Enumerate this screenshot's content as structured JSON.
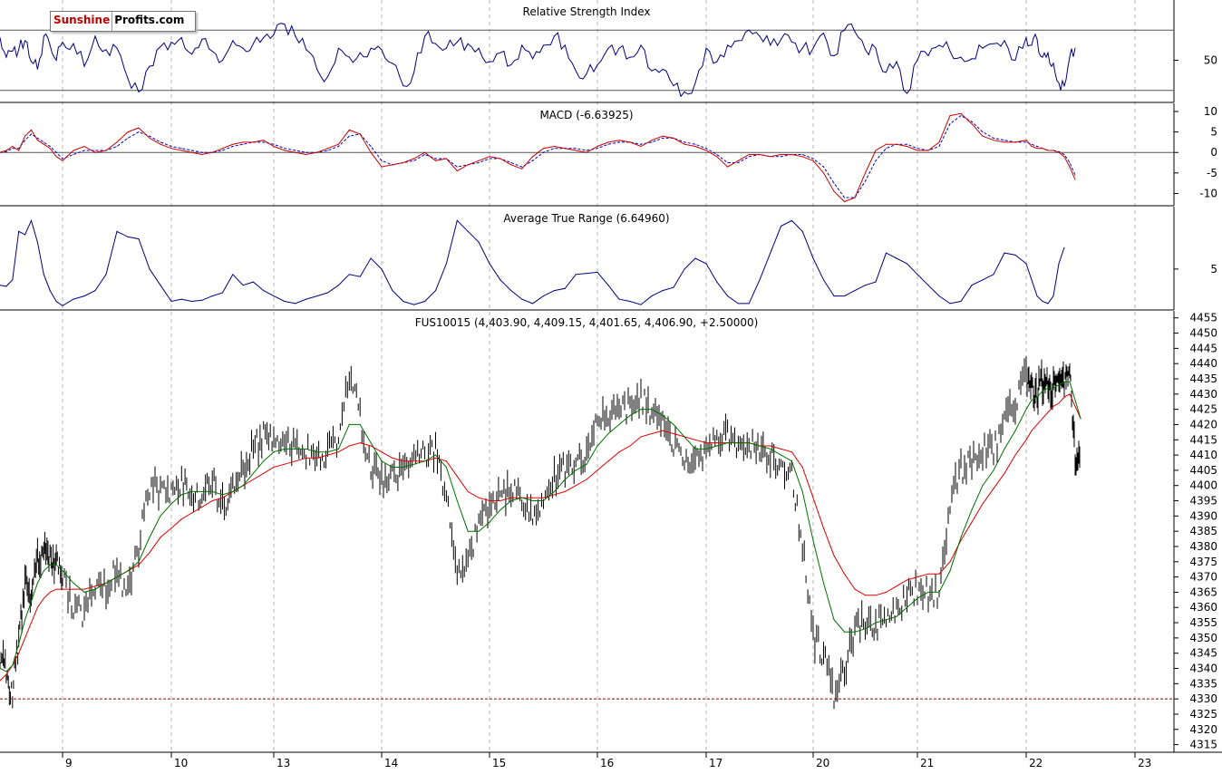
{
  "logo": {
    "part_a": "Sunshine",
    "part_b": "Profits.com"
  },
  "colors": {
    "price": "#000000",
    "rsi": "#000080",
    "macd": "#cc0000",
    "signal": "#0000cc",
    "atr": "#000080",
    "ma_short": "#007000",
    "ma_long": "#e00000",
    "grid": "#b4b4b4",
    "support": "#8b0000"
  },
  "chart_data": [
    {
      "type": "line",
      "title": "Relative Strength Index",
      "y_ticks": [
        50
      ],
      "reference_lines": [
        30,
        70
      ],
      "ylim": [
        22,
        90
      ],
      "series": [
        {
          "values": [
            65,
            52,
            56,
            57,
            63,
            49,
            44,
            66,
            60,
            50,
            62,
            61,
            46,
            66,
            57,
            58,
            38,
            29,
            46,
            59,
            62,
            65,
            54,
            64,
            56,
            50,
            63,
            58,
            61,
            65,
            67,
            74,
            66,
            57,
            44,
            39,
            58,
            52,
            55,
            58,
            57,
            48,
            33,
            42,
            66,
            61,
            58,
            62,
            61,
            58,
            49,
            55,
            47,
            60,
            51,
            60,
            66,
            60,
            43,
            41,
            47,
            58,
            58,
            52,
            60,
            43,
            44,
            33,
            29,
            35,
            58,
            49,
            60,
            63,
            70,
            66,
            60,
            64,
            62,
            58,
            58,
            68,
            53,
            70,
            69,
            57,
            58,
            42,
            49,
            28,
            50,
            53,
            60,
            56,
            52,
            51,
            58,
            61,
            63,
            50,
            65,
            60,
            64,
            52,
            55,
            48,
            35,
            33,
            52,
            58
          ]
        }
      ]
    },
    {
      "type": "line",
      "title": "MACD (-6.63925)",
      "y_ticks": [
        10,
        5,
        0,
        -5,
        -10
      ],
      "ylim": [
        -13,
        12
      ],
      "series": [
        {
          "values": [
            0.0,
            0.5,
            1.5,
            0.5,
            4.0,
            5.5,
            3.0,
            2.0,
            1.0,
            -1.0,
            -2.0,
            0.5,
            1.5,
            0.0,
            0.5,
            2.5,
            5.0,
            6.0,
            3.5,
            2.0,
            1.0,
            0.5,
            0.0,
            -0.5,
            0.0,
            1.0,
            2.0,
            2.5,
            2.5,
            3.0,
            1.5,
            0.5,
            0.0,
            -0.5,
            0.0,
            1.0,
            2.0,
            5.5,
            4.5,
            0.0,
            -3.5,
            -3.0,
            -2.5,
            -1.5,
            0.0,
            -2.0,
            -1.5,
            -4.5,
            -3.0,
            -2.0,
            -1.0,
            -1.5,
            -3.0,
            -4.0,
            -1.0,
            1.0,
            1.5,
            1.0,
            0.5,
            0.0,
            1.5,
            2.5,
            3.0,
            2.5,
            1.5,
            3.0,
            4.0,
            3.5,
            2.0,
            1.5,
            0.5,
            -1.0,
            -3.5,
            -2.0,
            -0.5,
            -0.5,
            -1.0,
            -0.5,
            -0.5,
            -1.0,
            -2.0,
            -5.0,
            -9.5,
            -12.0,
            -11.0,
            -5.0,
            0.5,
            2.0,
            2.0,
            1.5,
            0.5,
            0.5,
            2.5,
            9.0,
            9.5,
            7.0,
            4.0,
            3.0,
            2.5,
            2.5,
            3.0,
            1.5,
            1.0,
            1.0,
            0.5,
            0.5,
            0.0,
            -1.0,
            -3.5,
            -6.6
          ]
        },
        {
          "values": [
            0.0,
            0.2,
            1.0,
            1.0,
            3.0,
            4.5,
            3.5,
            2.5,
            1.5,
            0.0,
            -1.5,
            -0.5,
            0.5,
            0.5,
            0.5,
            1.5,
            3.5,
            5.0,
            4.0,
            2.5,
            1.5,
            1.0,
            0.5,
            0.0,
            0.0,
            0.5,
            1.5,
            2.0,
            2.5,
            2.5,
            2.0,
            1.0,
            0.5,
            0.0,
            0.0,
            0.5,
            1.5,
            4.0,
            4.5,
            1.5,
            -2.0,
            -3.0,
            -2.5,
            -2.0,
            -0.5,
            -1.5,
            -1.5,
            -3.5,
            -3.0,
            -2.5,
            -1.5,
            -1.5,
            -2.5,
            -3.5,
            -2.0,
            0.0,
            1.0,
            1.0,
            1.0,
            0.5,
            1.0,
            2.0,
            2.5,
            2.5,
            2.0,
            2.5,
            3.5,
            3.5,
            2.5,
            2.0,
            1.0,
            -0.5,
            -2.5,
            -2.5,
            -1.0,
            -0.5,
            -1.0,
            -1.0,
            -0.5,
            -0.5,
            -1.5,
            -3.5,
            -7.5,
            -11.0,
            -11.0,
            -7.0,
            -2.0,
            1.0,
            2.0,
            2.0,
            1.0,
            0.5,
            1.5,
            7.0,
            9.0,
            7.5,
            5.0,
            3.5,
            3.0,
            2.5,
            2.5,
            2.0,
            1.5,
            1.0,
            0.5,
            0.5,
            0.2,
            -0.5,
            -2.5,
            -5.5
          ]
        }
      ]
    },
    {
      "type": "line",
      "title": "Average True Range (6.64960)",
      "y_ticks": [
        5
      ],
      "ylim": [
        1.2,
        10.8
      ],
      "series": [
        {
          "values": [
            3.5,
            3.4,
            4.0,
            8.5,
            8.2,
            9.5,
            7.5,
            4.5,
            3.0,
            2.0,
            1.6,
            2.2,
            2.5,
            3.0,
            4.5,
            8.5,
            8.0,
            7.8,
            5.0,
            3.5,
            2.0,
            2.2,
            2.0,
            2.1,
            2.5,
            2.8,
            4.5,
            3.5,
            3.8,
            3.0,
            2.5,
            2.0,
            1.8,
            2.2,
            2.5,
            2.8,
            3.5,
            4.5,
            4.3,
            6.0,
            5.0,
            3.0,
            2.0,
            1.7,
            2.0,
            3.0,
            5.5,
            9.5,
            8.5,
            7.5,
            5.5,
            4.0,
            3.0,
            2.2,
            1.8,
            2.5,
            3.0,
            3.2,
            4.5,
            4.6,
            4.7,
            3.5,
            2.2,
            2.0,
            1.7,
            2.5,
            3.0,
            3.3,
            5.0,
            6.0,
            5.5,
            3.8,
            2.5,
            1.8,
            1.8,
            4.0,
            6.5,
            9.0,
            9.5,
            8.5,
            6.0,
            4.0,
            2.5,
            2.5,
            3.0,
            3.5,
            3.8,
            6.5,
            6.0,
            5.5,
            4.5,
            3.5,
            2.5,
            1.8,
            2.0,
            3.5,
            4.0,
            4.5,
            6.5,
            6.3,
            5.5,
            4.0,
            2.5,
            2.0,
            1.8,
            2.5,
            5.5,
            7.0
          ]
        }
      ]
    },
    {
      "type": "line",
      "title": "FUS10015 (4,403.90, 4,409.15, 4,401.65, 4,406.90, +2.50000)",
      "y_ticks": [
        4455,
        4450,
        4445,
        4440,
        4435,
        4430,
        4425,
        4420,
        4415,
        4410,
        4405,
        4400,
        4395,
        4390,
        4385,
        4380,
        4375,
        4370,
        4365,
        4360,
        4355,
        4350,
        4345,
        4340,
        4335,
        4330,
        4325,
        4320,
        4315
      ],
      "ylim": [
        4312.5,
        4457.3
      ],
      "x_ticks": [
        "9",
        "10",
        "13",
        "14",
        "15",
        "16",
        "17",
        "20",
        "21",
        "22",
        "23"
      ],
      "reference_lines": [
        4330
      ],
      "series": [
        {
          "name": "",
          "values": [
            4345,
            4338,
            4332,
            4350,
            4368,
            4362,
            4376,
            4378,
            4377,
            4375,
            4369,
            4360,
            4357,
            4368,
            4367,
            4372,
            4365,
            4380,
            4400,
            4398,
            4399,
            4400,
            4398,
            4396,
            4401,
            4393,
            4400,
            4405,
            4412,
            4416,
            4416,
            4415,
            4413,
            4411,
            4408,
            4412,
            4415,
            4438,
            4422,
            4405,
            4402,
            4404,
            4405,
            4409,
            4410,
            4412,
            4396,
            4370,
            4375,
            4386,
            4394,
            4398,
            4398,
            4395,
            4392,
            4394,
            4403,
            4406,
            4408,
            4410,
            4424,
            4424,
            4425,
            4426,
            4428,
            4424,
            4420,
            4414,
            4408,
            4406,
            4412,
            4414,
            4416,
            4414,
            4413,
            4412,
            4410,
            4408,
            4405,
            4380,
            4350,
            4345,
            4332,
            4340,
            4352,
            4355,
            4355,
            4355,
            4358,
            4365,
            4366,
            4365,
            4365,
            4395,
            4405,
            4408,
            4412,
            4412,
            4420,
            4428,
            4435,
            4432,
            4430,
            4434,
            4432,
            4432,
            4434,
            4433,
            4437,
            4410,
            4407
          ]
        },
        {
          "name": "",
          "values": [
            4340,
            4339,
            4341,
            4348,
            4356,
            4362,
            4368,
            4372,
            4374,
            4374,
            4372,
            4368,
            4365,
            4366,
            4368,
            4370,
            4372,
            4375,
            4383,
            4390,
            4394,
            4397,
            4398,
            4398,
            4398,
            4397,
            4398,
            4400,
            4404,
            4408,
            4411,
            4412,
            4412,
            4412,
            4411,
            4411,
            4412,
            4420,
            4420,
            4414,
            4408,
            4406,
            4406,
            4407,
            4408,
            4410,
            4406,
            4395,
            4385,
            4385,
            4388,
            4392,
            4395,
            4396,
            4395,
            4395,
            4398,
            4402,
            4405,
            4407,
            4413,
            4417,
            4420,
            4423,
            4425,
            4425,
            4423,
            4420,
            4416,
            4412,
            4412,
            4413,
            4414,
            4414,
            4414,
            4413,
            4412,
            4410,
            4408,
            4398,
            4382,
            4368,
            4356,
            4352,
            4352,
            4353,
            4355,
            4356,
            4357,
            4360,
            4363,
            4365,
            4365,
            4372,
            4383,
            4392,
            4400,
            4405,
            4412,
            4418,
            4425,
            4428,
            4429,
            4431,
            4432,
            4432,
            4433,
            4434,
            4434,
            4428,
            4422
          ]
        },
        {
          "name": "",
          "values": [
            4336,
            4338,
            4341,
            4345,
            4350,
            4355,
            4360,
            4363,
            4365,
            4366,
            4366,
            4366,
            4366,
            4367,
            4368,
            4370,
            4372,
            4374,
            4378,
            4383,
            4386,
            4389,
            4391,
            4393,
            4395,
            4396,
            4398,
            4400,
            4402,
            4404,
            4406,
            4407,
            4408,
            4409,
            4409,
            4410,
            4411,
            4413,
            4414,
            4413,
            4411,
            4409,
            4408,
            4408,
            4408,
            4409,
            4408,
            4403,
            4398,
            4396,
            4395,
            4395,
            4396,
            4396,
            4396,
            4396,
            4397,
            4398,
            4400,
            4402,
            4405,
            4408,
            4411,
            4413,
            4416,
            4417,
            4418,
            4417,
            4416,
            4415,
            4414,
            4414,
            4414,
            4414,
            4414,
            4413,
            4413,
            4412,
            4411,
            4406,
            4396,
            4386,
            4377,
            4371,
            4366,
            4364,
            4364,
            4365,
            4367,
            4369,
            4370,
            4371,
            4371,
            4375,
            4382,
            4388,
            4394,
            4399,
            4404,
            4410,
            4415,
            4418,
            4420,
            4422,
            4424,
            4426,
            4427,
            4429,
            4430,
            4426,
            4422
          ]
        }
      ]
    }
  ]
}
